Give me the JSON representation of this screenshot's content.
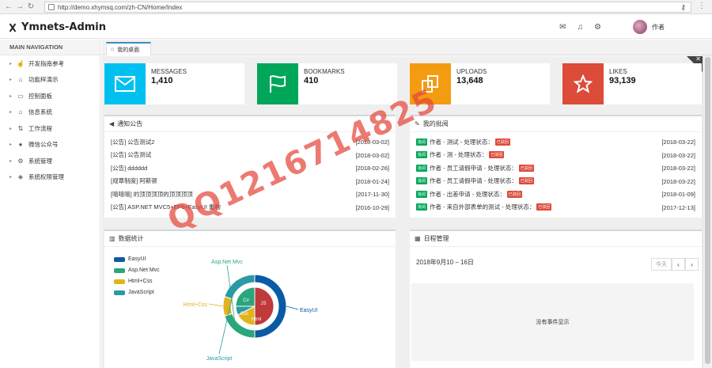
{
  "browser": {
    "url": "http://demo.xhymsq.com/zh-CN/Home/Index"
  },
  "header": {
    "app_title": "Ymnets-Admin",
    "user_name": "作者"
  },
  "sidebar": {
    "title": "MAIN NAVIGATION",
    "items": [
      {
        "label": "开发指南参考",
        "icon": "hand-pointer-icon"
      },
      {
        "label": "功能样演示",
        "icon": "home-icon"
      },
      {
        "label": "控制面板",
        "icon": "monitor-icon"
      },
      {
        "label": "信息系统",
        "icon": "bank-icon"
      },
      {
        "label": "工作流程",
        "icon": "sort-icon"
      },
      {
        "label": "微信公众号",
        "icon": "wechat-icon"
      },
      {
        "label": "系统管理",
        "icon": "gears-icon"
      },
      {
        "label": "系统权限管理",
        "icon": "shield-icon"
      }
    ]
  },
  "tabs": [
    {
      "label": "我的桌面",
      "icon": "home-icon"
    }
  ],
  "stats": [
    {
      "label": "MESSAGES",
      "value": "1,410",
      "color": "#00c0ef",
      "icon": "envelope-icon"
    },
    {
      "label": "BOOKMARKS",
      "value": "410",
      "color": "#00a65a",
      "icon": "flag-icon"
    },
    {
      "label": "UPLOADS",
      "value": "13,648",
      "color": "#f39c12",
      "icon": "files-icon"
    },
    {
      "label": "LIKES",
      "value": "93,139",
      "color": "#dd4b39",
      "icon": "star-icon"
    }
  ],
  "notices": {
    "title": "通知公告",
    "items": [
      {
        "text": "[公告] 公告测试2",
        "date": "[2018-03-02]"
      },
      {
        "text": "[公告] 公告测试",
        "date": "[2018-03-02]"
      },
      {
        "text": "[公告] dddddd",
        "date": "[2018-02-26]"
      },
      {
        "text": "[规章制度] 阿斯顿",
        "date": "[2018-01-24]"
      },
      {
        "text": "[嘻嘻嘻] 的顶顶顶顶的顶顶顶顶",
        "date": "[2017-11-30]"
      },
      {
        "text": "[公告] ASP.NET MVC5+EF6+EasyUI 重构",
        "date": "[2016-10-29]"
      }
    ]
  },
  "approvals": {
    "title": "我的批阅",
    "items": [
      {
        "tag": "批阅",
        "text": "作者 - 测试 - 处理状态：",
        "status": "已驳回",
        "date": "[2018-03-22]"
      },
      {
        "tag": "批阅",
        "text": "作者 - 测 - 处理状态：",
        "status": "已驳回",
        "date": "[2018-03-22]"
      },
      {
        "tag": "批阅",
        "text": "作者 - 员工请假申请 - 处理状态：",
        "status": "已驳回",
        "date": "[2018-03-22]"
      },
      {
        "tag": "批阅",
        "text": "作者 - 员工请假申请 - 处理状态：",
        "status": "已驳回",
        "date": "[2018-03-22]"
      },
      {
        "tag": "批阅",
        "text": "作者 - 出差申请 - 处理状态：",
        "status": "已驳回",
        "date": "[2018-01-09]"
      },
      {
        "tag": "批阅",
        "text": "作者 - 来自外部表单的测试 - 处理状态：",
        "status": "已驳回",
        "date": "[2017-12-13]"
      }
    ]
  },
  "stats_panel": {
    "title": "数据统计",
    "legend": [
      {
        "name": "EasyUI",
        "color": "#0b5aa5"
      },
      {
        "name": "Asp.Net Mvc",
        "color": "#2aa67a"
      },
      {
        "name": "Html+Css",
        "color": "#e0b41c"
      },
      {
        "name": "JavaScript",
        "color": "#2a9aa5"
      }
    ],
    "center_labels": {
      "csharp": "C#",
      "js": "JS",
      "css": "Css",
      "html": "Html"
    }
  },
  "schedule": {
    "title": "日程管理",
    "range": "2018年9月10 – 16日",
    "today": "今天",
    "prev": "‹",
    "next": "›",
    "empty": "没有事件显示"
  },
  "watermark": "QQ1216714825",
  "chart_data": {
    "type": "pie",
    "categories": [
      "EasyUI",
      "Asp.Net Mvc",
      "Html+Css",
      "JavaScript"
    ],
    "values": [
      50,
      20,
      10,
      20
    ]
  }
}
